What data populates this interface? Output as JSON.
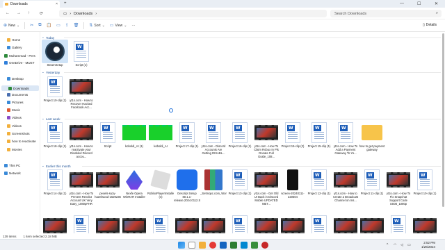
{
  "window": {
    "tab_title": "Downloads",
    "tab_close": "×",
    "new_tab": "+",
    "minimize": "—",
    "maximize": "☐",
    "close": "✕"
  },
  "address": {
    "path_root_icon": "monitor-icon",
    "separator": "›",
    "location": "Downloads",
    "search_placeholder": "Search Downloads"
  },
  "toolbar": {
    "new_label": "New",
    "sort_label": "Sort",
    "view_label": "View",
    "more_label": "···",
    "details_label": "Details"
  },
  "sidebar": {
    "items": [
      {
        "label": "Home",
        "color": "#f2b03c"
      },
      {
        "label": "Gallery",
        "color": "#3a8ad8"
      },
      {
        "label": "Muhammad - Pers",
        "color": "#2f8a3c"
      },
      {
        "label": "OneDrive - MUET",
        "color": "#2f7fdb"
      },
      {
        "label": "Desktop",
        "color": "#3a8ad8"
      },
      {
        "label": "Downloads",
        "color": "#2f8a3c"
      },
      {
        "label": "Documents",
        "color": "#4a6fb0"
      },
      {
        "label": "Pictures",
        "color": "#3a8ad8"
      },
      {
        "label": "Music",
        "color": "#e0582f"
      },
      {
        "label": "Videos",
        "color": "#8a4ac8"
      },
      {
        "label": "Videos",
        "color": "#f2b03c"
      },
      {
        "label": "Screenshots",
        "color": "#f2b03c"
      },
      {
        "label": "how to reactivate",
        "color": "#f2b03c"
      },
      {
        "label": "Movies",
        "color": "#f2b03c"
      },
      {
        "label": "This PC",
        "color": "#3a8ad8"
      },
      {
        "label": "Network",
        "color": "#3a8ad8"
      }
    ]
  },
  "groups": {
    "today": "Today",
    "yesterday": "Yesterday",
    "last_week": "Last week",
    "earlier": "Earlier this month"
  },
  "files": {
    "today": [
      {
        "name": "SteamSetup",
        "kind": "steam"
      },
      {
        "name": "Script (1)",
        "kind": "doc"
      }
    ],
    "yesterday": [
      {
        "name": "Project 10-clip (1)",
        "kind": "doc"
      },
      {
        "name": "yt1s.com - How to Recover Hacked Facebook Acc...",
        "kind": "video"
      }
    ],
    "last_week": [
      {
        "name": "Project 18-clip (1)",
        "kind": "doc"
      },
      {
        "name": "yt1s.com - How to reactivate your Disabled Discord accou...",
        "kind": "video"
      },
      {
        "name": "Script",
        "kind": "doc"
      },
      {
        "name": "koboldi_AI (1)",
        "kind": "green"
      },
      {
        "name": "koboldi_AI",
        "kind": "green"
      },
      {
        "name": "Project 17-clip (1)",
        "kind": "doc"
      },
      {
        "name": "yt1s.com - Discord Accounts Are Getting DISABL...",
        "kind": "doc"
      },
      {
        "name": "Project 16-clip (1)",
        "kind": "doc"
      },
      {
        "name": "yt1s.com - How To Claim Robux In Pls Donate Full Guide_108...",
        "kind": "video"
      },
      {
        "name": "Project 15-clip (2)",
        "kind": "doc"
      },
      {
        "name": "Project 15-clip (1)",
        "kind": "doc"
      },
      {
        "name": "yt1s.com - How To Add a Payment Gateway To Yo...",
        "kind": "doc"
      },
      {
        "name": "how to get payment gateway",
        "kind": "folder"
      }
    ],
    "earlier": [
      {
        "name": "Project 14-clip (1)",
        "kind": "doc"
      },
      {
        "name": "yt1s.com - How To Prevent Revolut Account UK Very Easy_1080pFHR",
        "kind": "video"
      },
      {
        "name": "pexels-suzy-hazelwood-1629236",
        "kind": "video"
      },
      {
        "name": "Nexfe Opera WinRAR Installer",
        "kind": "nexfe"
      },
      {
        "name": "RobloxPlayerInstaller (4)",
        "kind": "roblox"
      },
      {
        "name": "Descript Setup 80.1.1-release.2024.0112.S1921",
        "kind": "descript"
      },
      {
        "name": "_Setmopc.com_Wondershare_Filmora_12.0.12.1450",
        "kind": "winrar"
      },
      {
        "name": "Project 13-clip (1)",
        "kind": "doc"
      },
      {
        "name": "yt1s.com - Get Old UI Back in Discord Mobile UPDATED MET...",
        "kind": "video"
      },
      {
        "name": "screen-20240111-220504",
        "kind": "phone"
      },
      {
        "name": "Project 12-clip (1)",
        "kind": "doc"
      },
      {
        "name": "yt1s.com - How to Create a Broadcast Channel on Ins...",
        "kind": "video"
      },
      {
        "name": "Project 11-clip (1)",
        "kind": "doc"
      },
      {
        "name": "yt1s.com - How To Fix Snapchat Support Code SS06_1080p",
        "kind": "video"
      },
      {
        "name": "Project 10-clip (1)",
        "kind": "doc"
      }
    ]
  },
  "status": {
    "items_count": "139 items",
    "selection": "1 item selected  2.18 MB"
  },
  "taskbar": {
    "time": "2:52 PM",
    "date": "1/26/2024"
  }
}
